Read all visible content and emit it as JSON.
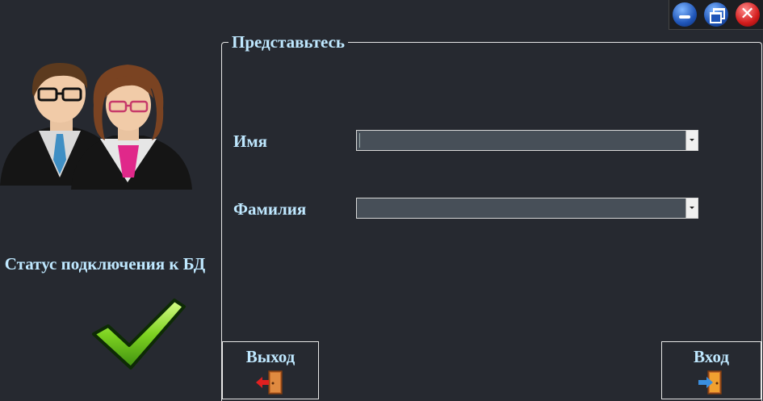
{
  "window_controls": {
    "minimize_icon": "minimize-icon",
    "restore_icon": "restore-icon",
    "close_icon": "close-icon"
  },
  "sidebar": {
    "users_icon": "users-icon",
    "status_label": "Статус подключения к БД",
    "status_icon": "check-icon",
    "status_color": "#7ed321"
  },
  "login_group": {
    "title": "Представьтесь",
    "name_label": "Имя",
    "name_value": "",
    "surname_label": "Фамилия",
    "surname_value": ""
  },
  "buttons": {
    "exit_label": "Выход",
    "exit_icon": "door-exit-icon",
    "login_label": "Вход",
    "login_icon": "door-enter-icon"
  },
  "colors": {
    "background": "#262930",
    "label_text": "#bfe8ff",
    "combo_fill": "#474f58"
  }
}
